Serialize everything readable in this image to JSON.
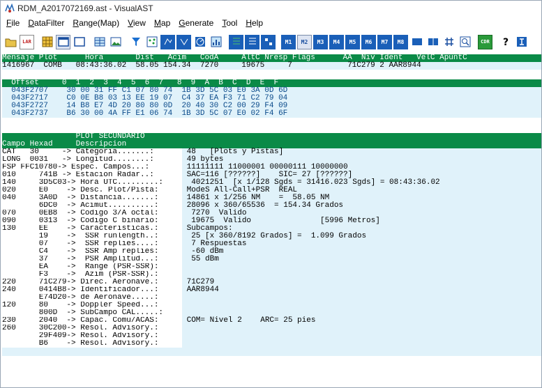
{
  "window": {
    "title": "RDM_A2017072169.ast - VisualAST"
  },
  "menu": [
    "File",
    "DataFilter",
    "Range(Map)",
    "View",
    "Map",
    "Generate",
    "Tool",
    "Help"
  ],
  "menu_underline": [
    "F",
    "D",
    "R",
    "V",
    "M",
    "G",
    "T",
    "H"
  ],
  "toolbar": {
    "labels": [
      "M1",
      "M2",
      "M3",
      "M4",
      "M5",
      "M6",
      "M7",
      "M8"
    ],
    "cdr": "CDR",
    "lar": "LAR"
  },
  "plot": {
    "header": "Mensaje Plot      Hora       Dist   Acim   CodA     AltC Nresp Flags      AA  Niv Ident   VelC ApuntC",
    "row": "1416967  COMB   08:43:36.02  58.05 154.34  7270     19675     7            71C279 2 AAR8944"
  },
  "raw": {
    "header": "  Offset     0  1  2  3  4  5  6  7   8  9  A  B  C  D  E  F",
    "rows": [
      "  043F2707    30 00 31 FF C1 07 80 74  1B 3D 5C 03 E0 3A 0D 6D",
      "  043F2717    C0 0E B8 03 13 EE 19 07  C4 37 EA F3 71 C2 79 04",
      "  043F2727    14 B8 E7 4D 20 80 80 0D  20 40 30 C2 00 29 F4 09",
      "  043F2737    B6 30 00 4A FF E1 06 74  1B 3D 5C 07 E0 02 F4 6F"
    ]
  },
  "secondary": {
    "title": "                PLOT SECUNDARIO",
    "header": "Campo Hexad     Descripcion",
    "rows": [
      [
        "CAT   30     -> Categoria.......:",
        " 48   [Plots y Pistas]"
      ],
      [
        "LONG  0031   -> Longitud........:",
        " 49 bytes"
      ],
      [
        "FSP FFC10780-> Espec. Campos...:",
        " 11111111 11000001 00000111 10000000"
      ],
      [
        "010     741B -> Estacion Radar..:",
        " SAC=116 [??????]    SIC= 27 [??????]"
      ],
      [
        "140     3D5C03-> Hora UTC.........:",
        "  4021251  [x 1/128 Sgds = 31416.023 Sgds] = 08:43:36.02"
      ],
      [
        "020     E0    -> Desc. Plot/Pista:",
        " ModeS All-Call+PSR  REAL"
      ],
      [
        "040     3A0D  -> Distancia.......:",
        " 14861 x 1/256 NM    =  58.05 NM"
      ],
      [
        "        6DC0  -> Acimut..........:",
        " 28096 x 360/65536  = 154.34 Grados"
      ],
      [
        "070     0EB8  -> Codigo 3/A octal:",
        "  7270  Valido"
      ],
      [
        "090     0313  -> Codigo C binario:",
        "  19675  Valido               [5996 Metros]"
      ],
      [
        "130     EE    -> Caracteristicas.:",
        " Subcampos:"
      ],
      [
        "        19    ->  SSR runlength..:",
        "  25 [x 360/8192 Grados] =  1.099 Grados"
      ],
      [
        "        07    ->  SSR replies....:",
        "  7 Respuestas"
      ],
      [
        "        C4    ->  SSR Amp replies:",
        "  -60 dBm"
      ],
      [
        "        37    ->  PSR Amplitud...:",
        "  55 dBm"
      ],
      [
        "        EA    ->  Range (PSR-SSR):",
        ""
      ],
      [
        "        F3    ->  Azim (PSR-SSR).:",
        ""
      ],
      [
        "220     71C279-> Direc. Aeronave.:",
        " 71C279"
      ],
      [
        "240     0414B8-> Identificador...:",
        " AAR8944"
      ],
      [
        "        E74D20-> de Aeronave.....:",
        ""
      ],
      [
        "120     80    -> Doppler Speed...:",
        ""
      ],
      [
        "        800D  -> SubCampo CAL.....:",
        ""
      ],
      [
        "230     2040  -> Capac. Comu/ACAS:",
        " COM= Nivel 2    ARC= 25 pies"
      ],
      [
        "260     30C200-> Resol. Advisory.:",
        ""
      ],
      [
        "        29F409-> Resol. Advisory.:",
        ""
      ],
      [
        "        B6    -> Resol. Advisory.:",
        ""
      ]
    ]
  },
  "colors": {
    "green": "#0a8a47",
    "light_blue": "#e0f2fa"
  }
}
